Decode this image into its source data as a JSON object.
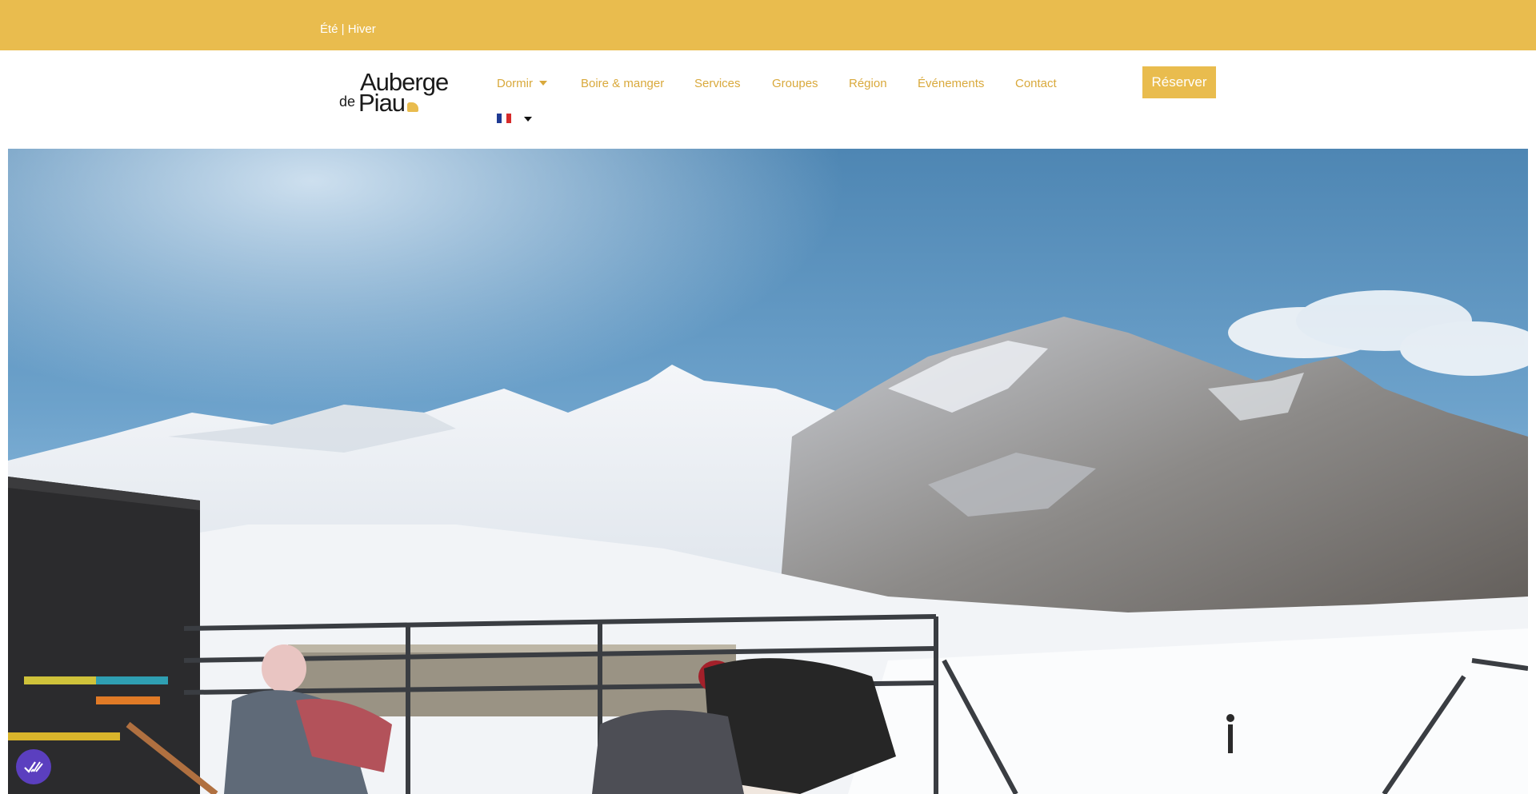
{
  "topbar": {
    "season_summer": "Été",
    "season_separator": " | ",
    "season_winter": "Hiver",
    "background_color": "#E9BC4E"
  },
  "logo": {
    "line1": "Auberge",
    "line2_prefix": "de",
    "line2": "Piau"
  },
  "nav": {
    "items": [
      {
        "label": "Dormir",
        "has_dropdown": true
      },
      {
        "label": "Boire & manger"
      },
      {
        "label": "Services"
      },
      {
        "label": "Groupes"
      },
      {
        "label": "Région"
      },
      {
        "label": "Événements"
      },
      {
        "label": "Contact"
      }
    ],
    "language": {
      "selected": "fr",
      "icon": "france-flag-icon"
    },
    "reserve_label": "Réserver",
    "link_color": "#D9A93C"
  },
  "hero": {
    "media": "mountain-snow-terrace-video"
  },
  "accessibility_widget": {
    "icon": "accessibility-check-icon",
    "color": "#5B3FBF"
  }
}
